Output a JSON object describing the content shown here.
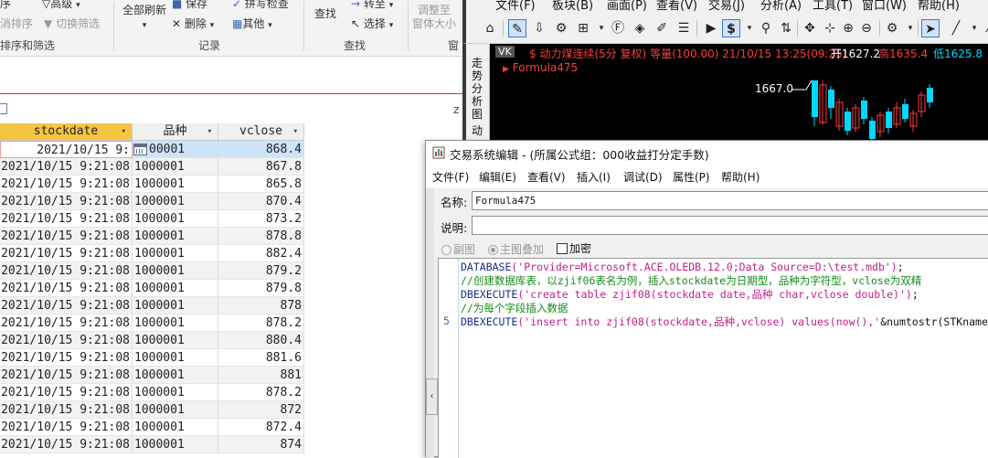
{
  "access": {
    "ribbon": {
      "sort_label": "序",
      "advanced_label": "高级",
      "cancel_sort_label": "消排序",
      "toggle_filter_label": "切换筛选",
      "sort_filter_group": "排序和筛选",
      "refresh_all_label": "全部刷新",
      "save_label": "保存",
      "spell_check_label": "拼写检查",
      "delete_label": "删除",
      "other_label": "其他",
      "records_group": "记录",
      "find_label": "查找",
      "goto_label": "转至",
      "select_label": "选择",
      "find_group": "查找",
      "resize_label_1": "调整至",
      "resize_label_2": "窗体大小",
      "window_group": "窗"
    },
    "tab_z": "z",
    "table": {
      "columns": [
        "stockdate",
        "品种",
        "vclose"
      ],
      "rows": [
        {
          "date": "2021/10/15 9:",
          "variety": "00001",
          "close": "868.4"
        },
        {
          "date": "2021/10/15 9:21:08",
          "variety": "1000001",
          "close": "867.8"
        },
        {
          "date": "2021/10/15 9:21:08",
          "variety": "1000001",
          "close": "865.8"
        },
        {
          "date": "2021/10/15 9:21:08",
          "variety": "1000001",
          "close": "870.4"
        },
        {
          "date": "2021/10/15 9:21:08",
          "variety": "1000001",
          "close": "873.2"
        },
        {
          "date": "2021/10/15 9:21:08",
          "variety": "1000001",
          "close": "878.8"
        },
        {
          "date": "2021/10/15 9:21:08",
          "variety": "1000001",
          "close": "882.4"
        },
        {
          "date": "2021/10/15 9:21:08",
          "variety": "1000001",
          "close": "879.2"
        },
        {
          "date": "2021/10/15 9:21:08",
          "variety": "1000001",
          "close": "879.8"
        },
        {
          "date": "2021/10/15 9:21:08",
          "variety": "1000001",
          "close": "878"
        },
        {
          "date": "2021/10/15 9:21:08",
          "variety": "1000001",
          "close": "878.2"
        },
        {
          "date": "2021/10/15 9:21:08",
          "variety": "1000001",
          "close": "880.4"
        },
        {
          "date": "2021/10/15 9:21:08",
          "variety": "1000001",
          "close": "881.6"
        },
        {
          "date": "2021/10/15 9:21:08",
          "variety": "1000001",
          "close": "881"
        },
        {
          "date": "2021/10/15 9:21:08",
          "variety": "1000001",
          "close": "878.2"
        },
        {
          "date": "2021/10/15 9:21:08",
          "variety": "1000001",
          "close": "872"
        },
        {
          "date": "2021/10/15 9:21:08",
          "variety": "1000001",
          "close": "872.4"
        },
        {
          "date": "2021/10/15 9:21:08",
          "variety": "1000001",
          "close": "874"
        }
      ]
    }
  },
  "trader": {
    "menu": [
      "文件(F)",
      "板块(B)",
      "画面(P)",
      "查看(V)",
      "交易(J)",
      "分析(A)",
      "工具(T)",
      "窗口(W)",
      "帮助(H)"
    ],
    "sidebar_text": "走势分析图",
    "sidebar_text2": "动",
    "chart": {
      "tag": "VK",
      "title": "$ 动力煤连续(5分 复权) 等量(100.00) 21/10/15 13:25(09:25)",
      "open_label": "开",
      "open_value": "1627.2",
      "high_label": "高",
      "high_value": "1635.4",
      "low_label": "低",
      "low_value": "1625.8",
      "formula_label": "Formula475",
      "price_label": "1667.0",
      "up_color": "#ff3b3b",
      "down_color": "#00d9ff"
    }
  },
  "dialog": {
    "title": "交易系统编辑 - (所属公式组：000收益打分定手数)",
    "menu": [
      "文件(F)",
      "编辑(E)",
      "查看(V)",
      "插入(I)",
      "调试(D)",
      "属性(P)",
      "帮助(H)"
    ],
    "name_label": "名称",
    "name_value": "Formula475",
    "desc_label": "说明",
    "desc_value": "",
    "radio_sub": "副图",
    "radio_main": "主图叠加",
    "encrypt_label": "加密",
    "line_number": "5",
    "code": {
      "l1_kw": "DATABASE",
      "l1_str": "('Provider=Microsoft.ACE.OLEDB.12.0;Data Source=D:\\test.mdb')",
      "l1_end": ";",
      "l2_comment": "//创建数据库表，以zjif06表名为例，插入stockdate为日期型，品种为字符型，vclose为双精",
      "l3_kw": "DBEXECUTE",
      "l3_str": "('create table zjif08(stockdate date,品种 char,vclose double)')",
      "l3_end": ";",
      "l4_comment": "//为每个字段插入数据",
      "l5_kw": "DBEXECUTE",
      "l5_str": "('insert into zjif08(stockdate,品种,vclose) values(now(),'",
      "l5_end": "&numtostr(STKname"
    }
  }
}
